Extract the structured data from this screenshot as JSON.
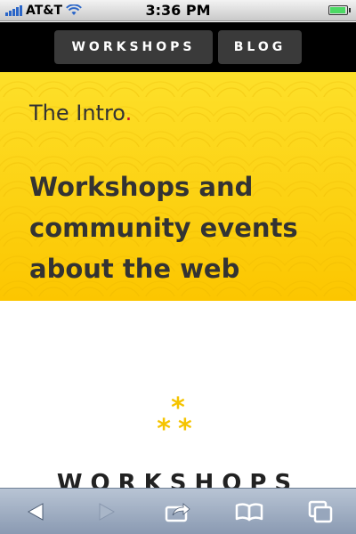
{
  "status_bar": {
    "carrier": "AT&T",
    "time": "3:36 PM",
    "icons": [
      "signal-icon",
      "wifi-icon",
      "battery-icon"
    ],
    "battery_level": 0.95
  },
  "nav": {
    "items": [
      {
        "label": "WORKSHOPS"
      },
      {
        "label": "BLOG"
      }
    ]
  },
  "hero": {
    "intro_text": "The Intro",
    "intro_dot": ".",
    "headline": "Workshops and community events about the web",
    "background_color": "#fdd400",
    "dot_color": "#c8102e"
  },
  "content": {
    "star_glyph": "*",
    "star_color": "#f5c400",
    "section_title": "WORKSHOPS"
  },
  "toolbar": {
    "icons": [
      "back-arrow-icon",
      "forward-arrow-icon",
      "share-icon",
      "bookmarks-icon",
      "tabs-icon"
    ]
  }
}
